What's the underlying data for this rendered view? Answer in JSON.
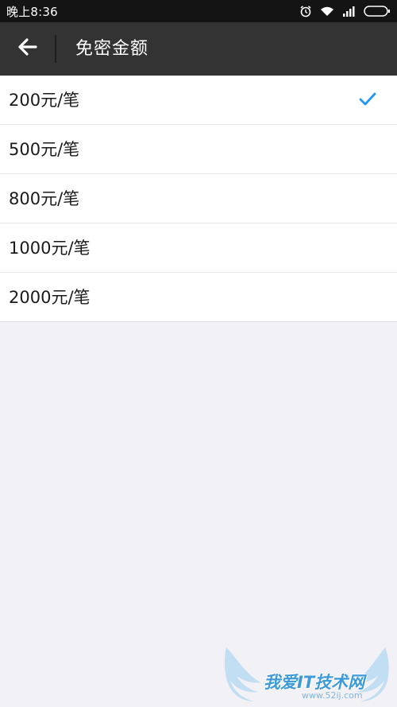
{
  "status_bar": {
    "time": "晚上8:36",
    "icons": [
      "alarm-icon",
      "wifi-icon",
      "signal-icon",
      "battery-icon"
    ]
  },
  "app_bar": {
    "back_icon": "arrow-left-icon",
    "title": "免密金额"
  },
  "options": [
    {
      "label": "200元/笔",
      "selected": true
    },
    {
      "label": "500元/笔",
      "selected": false
    },
    {
      "label": "800元/笔",
      "selected": false
    },
    {
      "label": "1000元/笔",
      "selected": false
    },
    {
      "label": "2000元/笔",
      "selected": false
    }
  ],
  "watermark": {
    "text": "我爱IT技术网",
    "url": "www.52ij.com"
  },
  "colors": {
    "status_bar": "#141414",
    "app_bar": "#333333",
    "background": "#f2f1f6",
    "check": "#2196f3"
  }
}
